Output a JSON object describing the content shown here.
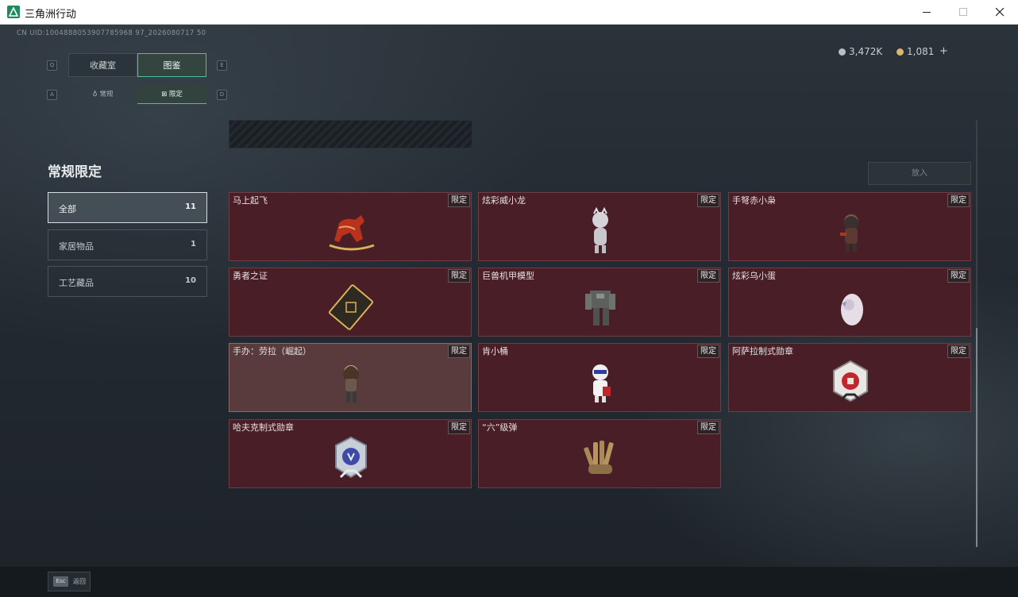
{
  "window": {
    "title": "三角洲行动"
  },
  "header": {
    "uid": "CN UID:1004888053907785968 97_2026080717 50",
    "currency_silver": "3,472K",
    "currency_gold": "1,081",
    "add_label": "+"
  },
  "tabs": [
    {
      "key": "Q",
      "label": "收藏室"
    },
    {
      "key": "E",
      "label": "图鉴"
    }
  ],
  "subtabs": [
    {
      "key": "A",
      "label": "常规"
    },
    {
      "key": "D",
      "label": "限定"
    }
  ],
  "section_title": "常规限定",
  "categories": [
    {
      "label": "全部",
      "count": "11"
    },
    {
      "label": "家居物品",
      "count": "1"
    },
    {
      "label": "工艺藏品",
      "count": "10"
    }
  ],
  "put_button": "放入",
  "badge_label": "限定",
  "items": [
    {
      "name": "马上起飞"
    },
    {
      "name": "炫彩威小龙"
    },
    {
      "name": "手弩赤小枭"
    },
    {
      "name": "勇者之证"
    },
    {
      "name": "巨兽机甲模型"
    },
    {
      "name": "炫彩乌小蛋"
    },
    {
      "name": "手办：劳拉（崛起）"
    },
    {
      "name": "肯小桶"
    },
    {
      "name": "阿萨拉制式勋章"
    },
    {
      "name": "哈夫克制式勋章"
    },
    {
      "name": "“六”级弹"
    }
  ],
  "footer": {
    "esc_key": "Esc",
    "esc_label": "返回"
  },
  "colors": {
    "accent": "#4fc19a",
    "card_bg": "#4a1e26",
    "card_hover_bg": "#5a3b3d"
  }
}
